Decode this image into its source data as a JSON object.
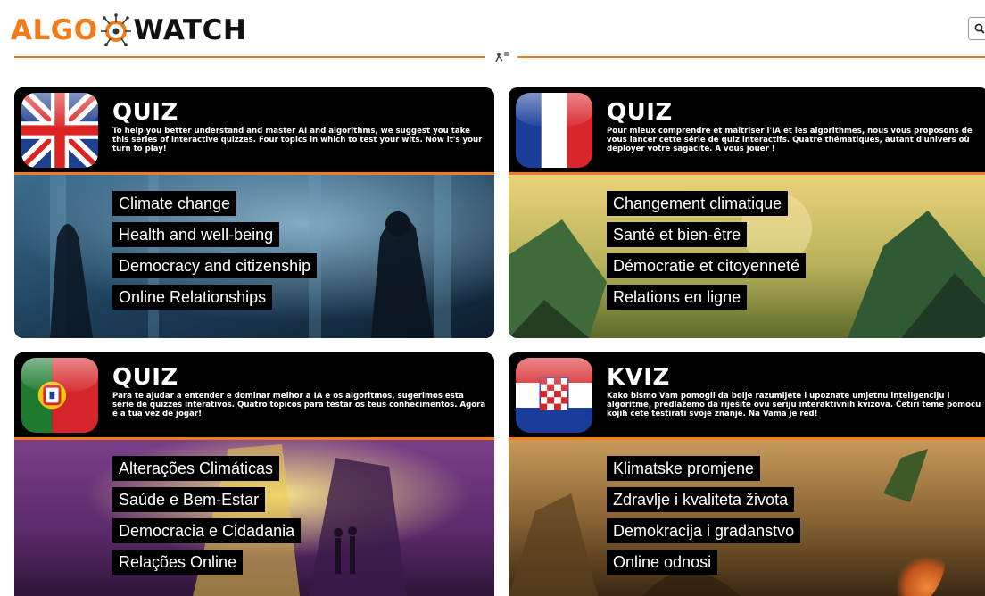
{
  "header": {
    "logo_left": "ALGO",
    "logo_right": "WATCH",
    "search_icon": "search-icon"
  },
  "colors": {
    "accent": "#f07d1a",
    "panel": "#000000",
    "text": "#ffffff"
  },
  "cards": [
    {
      "language": "en",
      "flag_icon": "uk-flag-icon",
      "title": "QUIZ",
      "description": "To help you better understand and master AI and algorithms, we suggest you take this series of interactive quizzes. Four topics in which to test your wits. Now it's your turn to play!",
      "topics": [
        "Climate change",
        "Health and well-being",
        "Democracy and citizenship",
        "Online Relationships"
      ]
    },
    {
      "language": "fr",
      "flag_icon": "france-flag-icon",
      "title": "QUIZ",
      "description": "Pour mieux comprendre et maîtriser l'IA et les algorithmes, nous vous proposons de vous lancer cette série de quiz interactifs. Quatre thématiques, autant d'univers où déployer votre sagacité. A vous jouer !",
      "topics": [
        "Changement climatique",
        "Santé et bien-être",
        "Démocratie et citoyenneté",
        "Relations en ligne"
      ]
    },
    {
      "language": "pt",
      "flag_icon": "portugal-flag-icon",
      "title": "QUIZ",
      "description": "Para te ajudar a entender e dominar melhor a IA e os algoritmos, sugerimos esta série de quizzes interativos. Quatro tópicos para testar os teus conhecimentos. Agora é a tua vez de jogar!",
      "topics": [
        "Alterações Climáticas",
        "Saúde e Bem-Estar",
        "Democracia e Cidadania",
        "Relações Online"
      ]
    },
    {
      "language": "hr",
      "flag_icon": "croatia-flag-icon",
      "title": "KVIZ",
      "description": "Kako bismo Vam pomogli da bolje razumijete i upoznate umjetnu inteligenciju i algoritme, predlažemo da riješite ovu seriju interaktivnih kvizova. Četiri teme pomoću kojih ćete testirati svoje znanje. Na Vama je red!",
      "topics": [
        "Klimatske promjene",
        "Zdravlje i kvaliteta života",
        "Demokracija i građanstvo",
        "Online odnosi"
      ]
    }
  ]
}
